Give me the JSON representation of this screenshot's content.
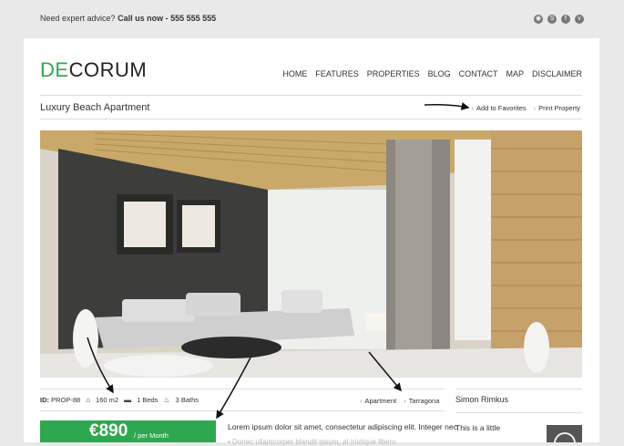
{
  "topbar": {
    "advice_prefix": "Need expert advice?",
    "advice_call": "Call us now - 555 555 555",
    "social": [
      "rss-icon",
      "skype-icon",
      "facebook-icon",
      "vimeo-icon"
    ]
  },
  "brand": {
    "logo_accent": "DE",
    "logo_rest": "CORUM",
    "accent_color": "#2ea84f"
  },
  "nav": [
    "HOME",
    "FEATURES",
    "PROPERTIES",
    "BLOG",
    "CONTACT",
    "MAP",
    "DISCLAIMER"
  ],
  "property": {
    "title": "Luxury Beach Apartment",
    "add_favorites": "Add to Favorites",
    "print": "Print Property",
    "id_label": "ID:",
    "id_value": "PROP-88",
    "area": "160 m2",
    "beds": "1 Beds",
    "baths": "3 Baths",
    "type": "Apartment",
    "location": "Tarragona"
  },
  "price": {
    "amount": "€890",
    "period": "/ per Month"
  },
  "description": {
    "line1": "Lorem ipsum dolor sit amet, consectetur adipiscing elit. Integer nec",
    "line2": "• Donec ullamcorper blandit ipsum, at tristique libero"
  },
  "agent": {
    "name": "Simon Rimkus",
    "intro": "This is a little"
  }
}
